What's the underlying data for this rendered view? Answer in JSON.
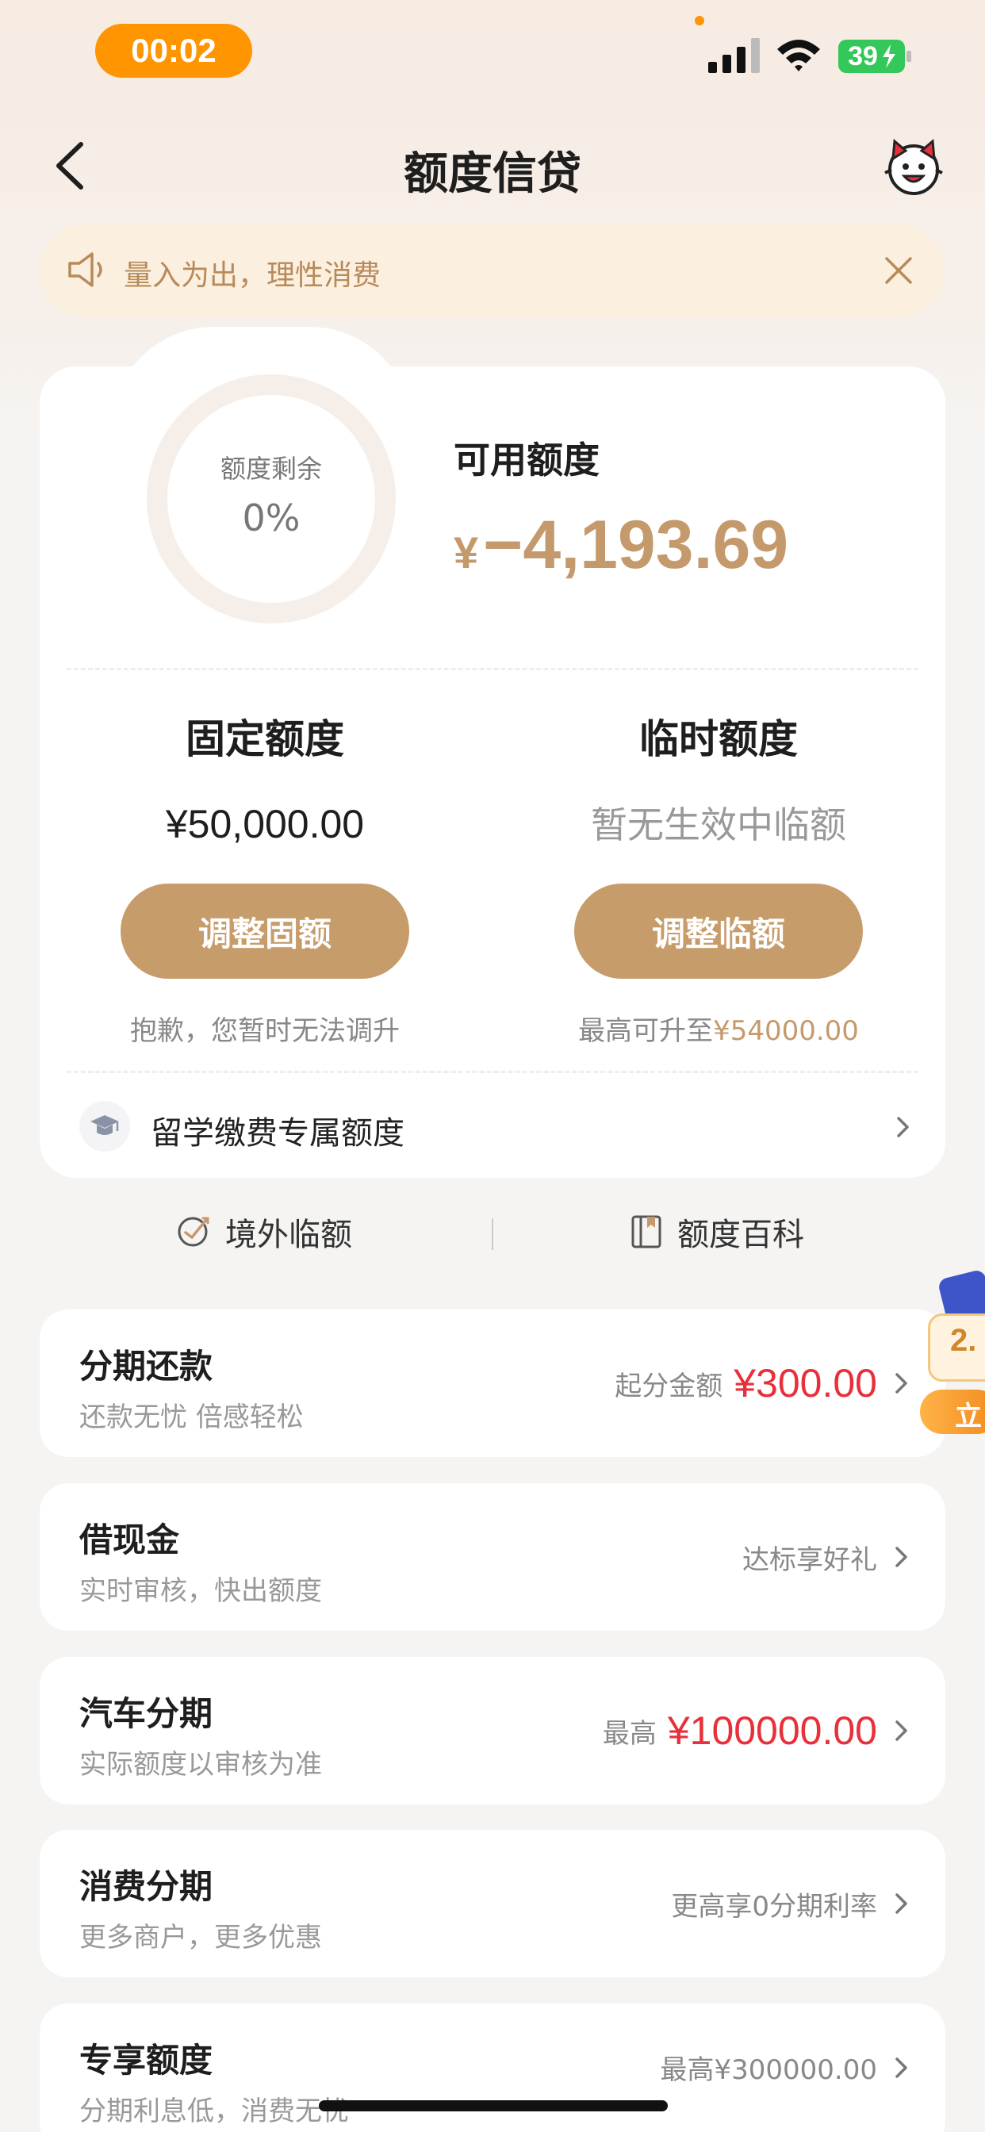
{
  "status_bar": {
    "time": "00:02",
    "battery": "39"
  },
  "nav": {
    "title": "额度信贷"
  },
  "notice": {
    "text": "量入为出，理性消费"
  },
  "credit": {
    "ring_label": "额度剩余",
    "ring_value": "0%",
    "ring_fraction": 0,
    "available_label": "可用额度",
    "available_currency": "¥",
    "available_amount": "−4,193.69",
    "fixed": {
      "title": "固定额度",
      "value": "¥50,000.00",
      "button": "调整固额",
      "note": "抱歉，您暂时无法调升"
    },
    "temp": {
      "title": "临时额度",
      "value": "暂无生效中临额",
      "button": "调整临额",
      "note_prefix": "最高可升至",
      "note_amount": "¥54000.00"
    },
    "study": {
      "label": "留学缴费专属额度"
    },
    "links": {
      "overseas": "境外临额",
      "encyclopedia": "额度百科"
    }
  },
  "list": [
    {
      "title": "分期还款",
      "subtitle": "还款无忧 倍感轻松",
      "right_prefix": "起分金额",
      "right_amount": "¥300.00"
    },
    {
      "title": "借现金",
      "subtitle": "实时审核，快出额度",
      "right_prefix": "达标享好礼",
      "right_amount": ""
    },
    {
      "title": "汽车分期",
      "subtitle": "实际额度以审核为准",
      "right_prefix": "最高",
      "right_amount": "¥100000.00"
    },
    {
      "title": "消费分期",
      "subtitle": "更多商户，更多优惠",
      "right_prefix": "更高享0分期利率",
      "right_amount": ""
    },
    {
      "title": "专享额度",
      "subtitle": "分期利息低，消费无忧",
      "right_prefix": "最高¥300000.00",
      "right_amount": ""
    }
  ],
  "promo": {
    "text1": "2.",
    "text2": "立"
  },
  "colors": {
    "accent_gold": "#c49a6c",
    "button_gold": "#c79c6b",
    "red": "#e8303a",
    "status_orange": "#ff9500",
    "battery_green": "#34c759"
  }
}
